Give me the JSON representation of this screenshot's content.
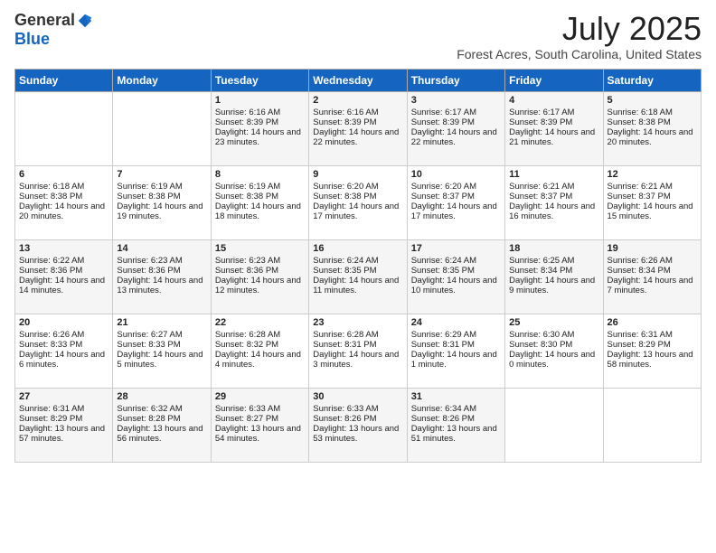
{
  "logo": {
    "general": "General",
    "blue": "Blue"
  },
  "header": {
    "month": "July 2025",
    "location": "Forest Acres, South Carolina, United States"
  },
  "weekdays": [
    "Sunday",
    "Monday",
    "Tuesday",
    "Wednesday",
    "Thursday",
    "Friday",
    "Saturday"
  ],
  "weeks": [
    [
      {
        "day": "",
        "content": ""
      },
      {
        "day": "",
        "content": ""
      },
      {
        "day": "1",
        "content": "Sunrise: 6:16 AM\nSunset: 8:39 PM\nDaylight: 14 hours and 23 minutes."
      },
      {
        "day": "2",
        "content": "Sunrise: 6:16 AM\nSunset: 8:39 PM\nDaylight: 14 hours and 22 minutes."
      },
      {
        "day": "3",
        "content": "Sunrise: 6:17 AM\nSunset: 8:39 PM\nDaylight: 14 hours and 22 minutes."
      },
      {
        "day": "4",
        "content": "Sunrise: 6:17 AM\nSunset: 8:39 PM\nDaylight: 14 hours and 21 minutes."
      },
      {
        "day": "5",
        "content": "Sunrise: 6:18 AM\nSunset: 8:38 PM\nDaylight: 14 hours and 20 minutes."
      }
    ],
    [
      {
        "day": "6",
        "content": "Sunrise: 6:18 AM\nSunset: 8:38 PM\nDaylight: 14 hours and 20 minutes."
      },
      {
        "day": "7",
        "content": "Sunrise: 6:19 AM\nSunset: 8:38 PM\nDaylight: 14 hours and 19 minutes."
      },
      {
        "day": "8",
        "content": "Sunrise: 6:19 AM\nSunset: 8:38 PM\nDaylight: 14 hours and 18 minutes."
      },
      {
        "day": "9",
        "content": "Sunrise: 6:20 AM\nSunset: 8:38 PM\nDaylight: 14 hours and 17 minutes."
      },
      {
        "day": "10",
        "content": "Sunrise: 6:20 AM\nSunset: 8:37 PM\nDaylight: 14 hours and 17 minutes."
      },
      {
        "day": "11",
        "content": "Sunrise: 6:21 AM\nSunset: 8:37 PM\nDaylight: 14 hours and 16 minutes."
      },
      {
        "day": "12",
        "content": "Sunrise: 6:21 AM\nSunset: 8:37 PM\nDaylight: 14 hours and 15 minutes."
      }
    ],
    [
      {
        "day": "13",
        "content": "Sunrise: 6:22 AM\nSunset: 8:36 PM\nDaylight: 14 hours and 14 minutes."
      },
      {
        "day": "14",
        "content": "Sunrise: 6:23 AM\nSunset: 8:36 PM\nDaylight: 14 hours and 13 minutes."
      },
      {
        "day": "15",
        "content": "Sunrise: 6:23 AM\nSunset: 8:36 PM\nDaylight: 14 hours and 12 minutes."
      },
      {
        "day": "16",
        "content": "Sunrise: 6:24 AM\nSunset: 8:35 PM\nDaylight: 14 hours and 11 minutes."
      },
      {
        "day": "17",
        "content": "Sunrise: 6:24 AM\nSunset: 8:35 PM\nDaylight: 14 hours and 10 minutes."
      },
      {
        "day": "18",
        "content": "Sunrise: 6:25 AM\nSunset: 8:34 PM\nDaylight: 14 hours and 9 minutes."
      },
      {
        "day": "19",
        "content": "Sunrise: 6:26 AM\nSunset: 8:34 PM\nDaylight: 14 hours and 7 minutes."
      }
    ],
    [
      {
        "day": "20",
        "content": "Sunrise: 6:26 AM\nSunset: 8:33 PM\nDaylight: 14 hours and 6 minutes."
      },
      {
        "day": "21",
        "content": "Sunrise: 6:27 AM\nSunset: 8:33 PM\nDaylight: 14 hours and 5 minutes."
      },
      {
        "day": "22",
        "content": "Sunrise: 6:28 AM\nSunset: 8:32 PM\nDaylight: 14 hours and 4 minutes."
      },
      {
        "day": "23",
        "content": "Sunrise: 6:28 AM\nSunset: 8:31 PM\nDaylight: 14 hours and 3 minutes."
      },
      {
        "day": "24",
        "content": "Sunrise: 6:29 AM\nSunset: 8:31 PM\nDaylight: 14 hours and 1 minute."
      },
      {
        "day": "25",
        "content": "Sunrise: 6:30 AM\nSunset: 8:30 PM\nDaylight: 14 hours and 0 minutes."
      },
      {
        "day": "26",
        "content": "Sunrise: 6:31 AM\nSunset: 8:29 PM\nDaylight: 13 hours and 58 minutes."
      }
    ],
    [
      {
        "day": "27",
        "content": "Sunrise: 6:31 AM\nSunset: 8:29 PM\nDaylight: 13 hours and 57 minutes."
      },
      {
        "day": "28",
        "content": "Sunrise: 6:32 AM\nSunset: 8:28 PM\nDaylight: 13 hours and 56 minutes."
      },
      {
        "day": "29",
        "content": "Sunrise: 6:33 AM\nSunset: 8:27 PM\nDaylight: 13 hours and 54 minutes."
      },
      {
        "day": "30",
        "content": "Sunrise: 6:33 AM\nSunset: 8:26 PM\nDaylight: 13 hours and 53 minutes."
      },
      {
        "day": "31",
        "content": "Sunrise: 6:34 AM\nSunset: 8:26 PM\nDaylight: 13 hours and 51 minutes."
      },
      {
        "day": "",
        "content": ""
      },
      {
        "day": "",
        "content": ""
      }
    ]
  ]
}
